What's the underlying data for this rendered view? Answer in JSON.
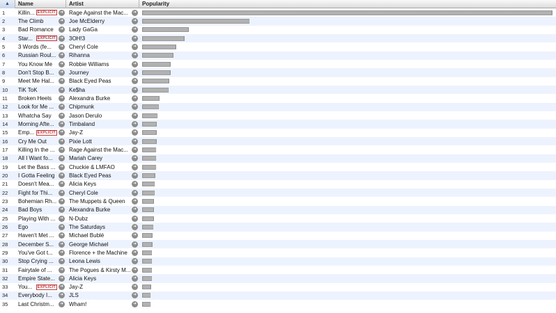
{
  "header": {
    "sort_indicator": "▲",
    "name": "Name",
    "artist": "Artist",
    "popularity": "Popularity"
  },
  "explicit_label": "EXPLICIT",
  "arrow_icon": "right-arrow-circle-icon",
  "rows": [
    {
      "num": "1",
      "name": "Killin...",
      "explicit": true,
      "artist": "Rage Against the Mac...",
      "popularity": 0.995
    },
    {
      "num": "2",
      "name": "The Climb",
      "explicit": false,
      "artist": "Joe McElderry",
      "popularity": 0.26
    },
    {
      "num": "3",
      "name": "Bad Romance",
      "explicit": false,
      "artist": "Lady GaGa",
      "popularity": 0.113
    },
    {
      "num": "4",
      "name": "Star...",
      "explicit": true,
      "artist": "3OH!3",
      "popularity": 0.103
    },
    {
      "num": "5",
      "name": "3 Words (fe...",
      "explicit": false,
      "artist": "Cheryl Cole",
      "popularity": 0.082
    },
    {
      "num": "6",
      "name": "Russian Roul...",
      "explicit": false,
      "artist": "Rihanna",
      "popularity": 0.076
    },
    {
      "num": "7",
      "name": "You Know Me",
      "explicit": false,
      "artist": "Robbie Williams",
      "popularity": 0.07
    },
    {
      "num": "8",
      "name": "Don't Stop B...",
      "explicit": false,
      "artist": "Journey",
      "popularity": 0.07
    },
    {
      "num": "9",
      "name": "Meet Me Hal...",
      "explicit": false,
      "artist": "Black Eyed Peas",
      "popularity": 0.066
    },
    {
      "num": "10",
      "name": "TiK ToK",
      "explicit": false,
      "artist": "Ke$ha",
      "popularity": 0.064
    },
    {
      "num": "11",
      "name": "Broken Heels",
      "explicit": false,
      "artist": "Alexandra Burke",
      "popularity": 0.042
    },
    {
      "num": "12",
      "name": "Look for Me ...",
      "explicit": false,
      "artist": "Chipmunk",
      "popularity": 0.04
    },
    {
      "num": "13",
      "name": "Whatcha Say",
      "explicit": false,
      "artist": "Jason Derulo",
      "popularity": 0.038
    },
    {
      "num": "14",
      "name": "Morning Afte...",
      "explicit": false,
      "artist": "Timbaland",
      "popularity": 0.036
    },
    {
      "num": "15",
      "name": "Emp...",
      "explicit": true,
      "artist": "Jay-Z",
      "popularity": 0.036
    },
    {
      "num": "16",
      "name": "Cry Me Out",
      "explicit": false,
      "artist": "Pixie Lott",
      "popularity": 0.035
    },
    {
      "num": "17",
      "name": "Killing In the ...",
      "explicit": false,
      "artist": "Rage Against the Mac...",
      "popularity": 0.034
    },
    {
      "num": "18",
      "name": "All I Want fo...",
      "explicit": false,
      "artist": "Mariah Carey",
      "popularity": 0.033
    },
    {
      "num": "19",
      "name": "Let the Bass ...",
      "explicit": false,
      "artist": "Chuckie & LMFAO",
      "popularity": 0.033
    },
    {
      "num": "20",
      "name": "I Gotta Feeling",
      "explicit": false,
      "artist": "Black Eyed Peas",
      "popularity": 0.032
    },
    {
      "num": "21",
      "name": "Doesn't Mea...",
      "explicit": false,
      "artist": "Alicia Keys",
      "popularity": 0.031
    },
    {
      "num": "22",
      "name": "Fight for Thi...",
      "explicit": false,
      "artist": "Cheryl Cole",
      "popularity": 0.03
    },
    {
      "num": "23",
      "name": "Bohemian Rh...",
      "explicit": false,
      "artist": "The Muppets & Queen",
      "popularity": 0.029
    },
    {
      "num": "24",
      "name": "Bad Boys",
      "explicit": false,
      "artist": "Alexandra Burke",
      "popularity": 0.029
    },
    {
      "num": "25",
      "name": "Playing With ...",
      "explicit": false,
      "artist": "N-Dubz",
      "popularity": 0.028
    },
    {
      "num": "26",
      "name": "Ego",
      "explicit": false,
      "artist": "The Saturdays",
      "popularity": 0.027
    },
    {
      "num": "27",
      "name": "Haven't Met ...",
      "explicit": false,
      "artist": "Michael Bublé",
      "popularity": 0.026
    },
    {
      "num": "28",
      "name": "December S...",
      "explicit": false,
      "artist": "George Michael",
      "popularity": 0.025
    },
    {
      "num": "29",
      "name": "You've Got t...",
      "explicit": false,
      "artist": "Florence + the Machine",
      "popularity": 0.024
    },
    {
      "num": "30",
      "name": "Stop Crying ...",
      "explicit": false,
      "artist": "Leona Lewis",
      "popularity": 0.024
    },
    {
      "num": "31",
      "name": "Fairytale of ...",
      "explicit": false,
      "artist": "The Pogues & Kirsty M...",
      "popularity": 0.023
    },
    {
      "num": "32",
      "name": "Empire State...",
      "explicit": false,
      "artist": "Alicia Keys",
      "popularity": 0.023
    },
    {
      "num": "33",
      "name": "You...",
      "explicit": true,
      "artist": "Jay-Z",
      "popularity": 0.022
    },
    {
      "num": "34",
      "name": "Everybody I...",
      "explicit": false,
      "artist": "JLS",
      "popularity": 0.021
    },
    {
      "num": "35",
      "name": "Last Christm...",
      "explicit": false,
      "artist": "Wham!",
      "popularity": 0.02
    }
  ]
}
